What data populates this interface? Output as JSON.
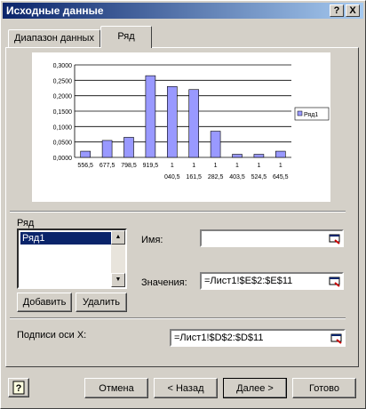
{
  "window": {
    "title": "Исходные данные"
  },
  "titlebar_buttons": {
    "help": "?",
    "close": "X"
  },
  "tabs": [
    {
      "label": "Диапазон данных",
      "active": false
    },
    {
      "label": "Ряд",
      "active": true
    }
  ],
  "chart_data": {
    "type": "bar",
    "categories": [
      "556,5",
      "677,5",
      "798,5",
      "919,5",
      "1 040,5",
      "1 161,5",
      "1 282,5",
      "1 403,5",
      "1 524,5",
      "1 645,5"
    ],
    "category_lines": [
      [
        "556,5",
        ""
      ],
      [
        "677,5",
        ""
      ],
      [
        "798,5",
        ""
      ],
      [
        "919,5",
        ""
      ],
      [
        "1",
        "040,5"
      ],
      [
        "1",
        "161,5"
      ],
      [
        "1",
        "282,5"
      ],
      [
        "1",
        "403,5"
      ],
      [
        "1",
        "524,5"
      ],
      [
        "1",
        "645,5"
      ]
    ],
    "series": [
      {
        "name": "Ряд1",
        "values": [
          0.02,
          0.055,
          0.065,
          0.265,
          0.23,
          0.22,
          0.085,
          0.01,
          0.01,
          0.02
        ]
      }
    ],
    "yticks": [
      "0,0000",
      "0,0500",
      "0,1000",
      "0,1500",
      "0,2000",
      "0,2500",
      "0,3000"
    ],
    "ylim": [
      0,
      0.3
    ],
    "legend": "right",
    "bar_color": "#9999ff"
  },
  "series_section": {
    "label": "Ряд",
    "items": [
      "Ряд1"
    ],
    "name_label": "Имя:",
    "name_value": "",
    "values_label": "Значения:",
    "values_value": "=Лист1!$E$2:$E$11",
    "add_button": "Добавить",
    "remove_button": "Удалить"
  },
  "x_labels": {
    "label": "Подписи оси X:",
    "value": "=Лист1!$D$2:$D$11"
  },
  "footer": {
    "help_icon": "help-icon",
    "cancel": "Отмена",
    "back": "< Назад",
    "next": "Далее >",
    "finish": "Готово"
  }
}
